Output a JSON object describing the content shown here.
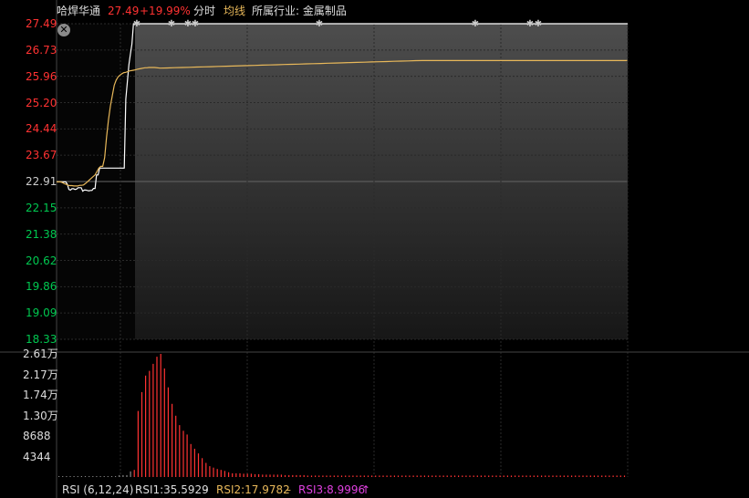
{
  "header": {
    "stock_name": "哈焊华通",
    "price": "27.49",
    "change_pct": "+19.99%",
    "tab_timeshare": "分时",
    "avg_line_label": "均线",
    "industry": "所属行业: 金属制品"
  },
  "close_icon": "close-icon",
  "price_axis": [
    "27.49",
    "26.73",
    "25.96",
    "25.20",
    "24.44",
    "23.67",
    "22.91",
    "22.15",
    "21.38",
    "20.62",
    "19.86",
    "19.09",
    "18.33"
  ],
  "volume_axis": [
    "2.61万",
    "2.17万",
    "1.74万",
    "1.30万",
    "8688",
    "4344"
  ],
  "footer": {
    "rsi_title": "RSI (6,12,24)",
    "rsi1": "RSI1:35.5929",
    "rsi2": "RSI2:17.9782",
    "rsi3": "RSI3:8.9996"
  },
  "colors": {
    "up": "#ff3232",
    "down": "#00c850",
    "neutral": "#cccccc",
    "price_line": "#ffffff",
    "avg_line": "#e8b85a",
    "rsi2": "#e8b85a",
    "rsi3": "#e040e0",
    "volume_bar": "#ff3232"
  },
  "chart_data": {
    "type": "line",
    "series": [
      {
        "values": [
          22.9,
          22.9,
          22.9,
          22.9,
          22.9,
          22.9,
          22.9,
          22.83,
          22.68,
          22.66,
          22.7,
          22.7,
          22.68,
          22.69,
          22.73,
          22.73,
          22.73,
          22.63,
          22.66,
          22.66,
          22.65,
          22.64,
          22.65,
          22.65,
          22.71,
          22.71,
          23.1,
          23.1,
          23.3,
          23.3,
          23.3,
          23.3,
          23.3,
          23.3,
          23.3,
          23.3,
          23.3,
          23.3,
          23.3,
          23.3,
          23.3,
          23.3,
          23.3,
          23.3,
          23.3,
          25.3,
          25.8,
          26.3,
          26.6,
          26.9,
          27.49,
          27.49
        ]
      },
      {
        "values": [
          22.9,
          22.9,
          22.9,
          22.88,
          22.85,
          22.83,
          22.8,
          22.79,
          22.79,
          22.78,
          22.78,
          22.78,
          22.8,
          22.8,
          22.81,
          22.85,
          22.9,
          22.95,
          23.0,
          23.05,
          23.1,
          23.2,
          23.3,
          23.35,
          23.35,
          23.6,
          24.2,
          24.7,
          25.1,
          25.4,
          25.7,
          25.85,
          25.95,
          26.0,
          26.04,
          26.07,
          26.08,
          26.1,
          26.12,
          26.13,
          26.14,
          26.15,
          26.17,
          26.18,
          26.19,
          26.2,
          26.21,
          26.21,
          26.22,
          26.22,
          26.22,
          26.22
        ]
      }
    ],
    "ylim": [
      18.33,
      27.49
    ],
    "volume": [
      30,
      30,
      30,
      30,
      30,
      30,
      30,
      30,
      30,
      30,
      30,
      30,
      30,
      30,
      200,
      200,
      400,
      400,
      400,
      1200,
      1500,
      14000,
      18000,
      21500,
      22500,
      24000,
      25500,
      26100,
      23000,
      19000,
      15500,
      13000,
      11000,
      9800,
      9000,
      7000,
      6000,
      5000,
      4000,
      3000,
      2300,
      2000,
      1700,
      1500,
      1300,
      1000,
      800,
      800,
      800,
      700,
      700,
      700,
      600,
      600,
      500,
      500,
      500,
      500,
      500,
      500,
      400,
      400,
      400,
      400,
      400,
      400,
      300,
      300,
      300,
      300,
      300,
      300,
      300,
      300,
      300,
      300,
      300,
      300,
      300,
      300,
      300,
      300,
      300,
      300,
      300,
      300,
      300,
      300,
      300,
      300,
      300,
      300,
      300,
      300,
      300,
      300,
      300,
      300,
      300,
      300,
      300,
      300,
      300,
      300,
      300,
      300,
      300,
      300,
      300,
      300,
      300,
      300,
      300,
      300,
      300,
      300,
      300,
      300,
      300,
      300,
      300,
      300,
      300,
      300,
      300,
      300,
      300,
      300,
      300,
      300,
      300,
      300,
      300,
      300,
      300,
      300,
      300,
      300,
      300,
      300,
      300,
      300,
      300,
      300,
      300,
      300,
      300,
      300,
      300,
      300,
      300
    ],
    "volume_max": 26100
  }
}
